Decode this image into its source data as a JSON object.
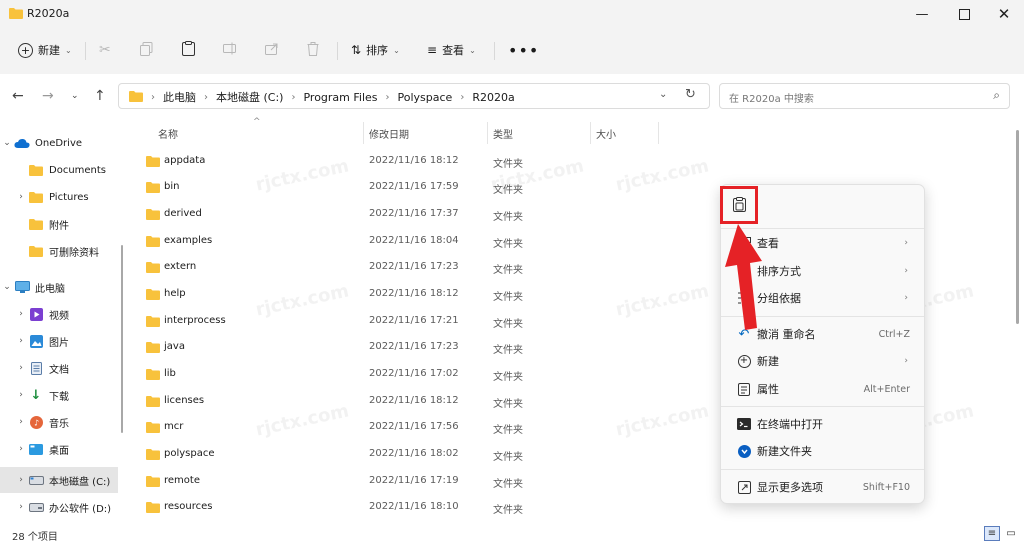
{
  "window": {
    "title": "R2020a"
  },
  "toolbar": {
    "new_label": "新建",
    "sort_label": "排序",
    "view_label": "查看"
  },
  "address": {
    "crumbs": [
      "此电脑",
      "本地磁盘 (C:)",
      "Program Files",
      "Polyspace",
      "R2020a"
    ],
    "search_placeholder": "在 R2020a 中搜索"
  },
  "sidebar": {
    "items": [
      {
        "label": "OneDrive",
        "icon": "cloud-icon",
        "expanded": true
      },
      {
        "label": "Documents",
        "icon": "folder-icon"
      },
      {
        "label": "Pictures",
        "icon": "folder-icon"
      },
      {
        "label": "附件",
        "icon": "folder-icon"
      },
      {
        "label": "可删除资料",
        "icon": "folder-icon"
      },
      {
        "label": "此电脑",
        "icon": "monitor-icon",
        "expanded": true
      },
      {
        "label": "视频",
        "icon": "video-icon"
      },
      {
        "label": "图片",
        "icon": "image-icon"
      },
      {
        "label": "文档",
        "icon": "document-icon"
      },
      {
        "label": "下载",
        "icon": "download-icon"
      },
      {
        "label": "音乐",
        "icon": "music-icon"
      },
      {
        "label": "桌面",
        "icon": "desktop-icon"
      },
      {
        "label": "本地磁盘 (C:)",
        "icon": "drive-icon",
        "selected": true
      },
      {
        "label": "办公软件 (D:)",
        "icon": "drive-icon"
      }
    ]
  },
  "columns": {
    "name": "名称",
    "date": "修改日期",
    "type": "类型",
    "size": "大小"
  },
  "files": [
    {
      "name": "appdata",
      "date": "2022/11/16 18:12",
      "type": "文件夹"
    },
    {
      "name": "bin",
      "date": "2022/11/16 17:59",
      "type": "文件夹"
    },
    {
      "name": "derived",
      "date": "2022/11/16 17:37",
      "type": "文件夹"
    },
    {
      "name": "examples",
      "date": "2022/11/16 18:04",
      "type": "文件夹"
    },
    {
      "name": "extern",
      "date": "2022/11/16 17:23",
      "type": "文件夹"
    },
    {
      "name": "help",
      "date": "2022/11/16 18:12",
      "type": "文件夹"
    },
    {
      "name": "interprocess",
      "date": "2022/11/16 17:21",
      "type": "文件夹"
    },
    {
      "name": "java",
      "date": "2022/11/16 17:23",
      "type": "文件夹"
    },
    {
      "name": "lib",
      "date": "2022/11/16 17:02",
      "type": "文件夹"
    },
    {
      "name": "licenses",
      "date": "2022/11/16 18:12",
      "type": "文件夹"
    },
    {
      "name": "mcr",
      "date": "2022/11/16 17:56",
      "type": "文件夹"
    },
    {
      "name": "polyspace",
      "date": "2022/11/16 18:02",
      "type": "文件夹"
    },
    {
      "name": "remote",
      "date": "2022/11/16 17:19",
      "type": "文件夹"
    },
    {
      "name": "resources",
      "date": "2022/11/16 18:10",
      "type": "文件夹"
    }
  ],
  "status": {
    "count": "28 个项目"
  },
  "context_menu": {
    "items": [
      {
        "label": "查看",
        "shortcut": "",
        "submenu": true
      },
      {
        "label": "排序方式",
        "shortcut": "",
        "submenu": true
      },
      {
        "label": "分组依据",
        "shortcut": "",
        "submenu": true
      },
      {
        "label": "撤消 重命名",
        "shortcut": "Ctrl+Z",
        "submenu": false
      },
      {
        "label": "新建",
        "shortcut": "",
        "submenu": true
      },
      {
        "label": "属性",
        "shortcut": "Alt+Enter",
        "submenu": false
      },
      {
        "label": "在终端中打开",
        "shortcut": "",
        "submenu": false
      },
      {
        "label": "新建文件夹",
        "shortcut": "",
        "submenu": false
      },
      {
        "label": "显示更多选项",
        "shortcut": "Shift+F10",
        "submenu": false
      }
    ]
  },
  "watermark": "rjctx.com",
  "colors": {
    "accent": "#0067c0",
    "folder": "#f8c23c",
    "highlight": "#e52226"
  }
}
